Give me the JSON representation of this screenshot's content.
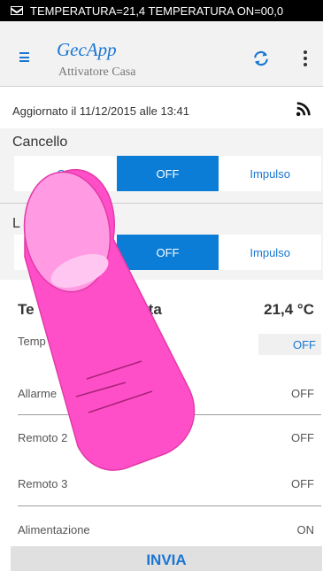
{
  "status_bar": {
    "notification": "TEMPERATURA=21,4 TEMPERATURA ON=00,0"
  },
  "header": {
    "title": "GecApp",
    "subtitle": "Attivatore Casa"
  },
  "updated": "Aggiornato il 11/12/2015 alle 13:41",
  "cancello": {
    "title": "Cancello",
    "options": [
      "ON",
      "OFF",
      "Impulso"
    ],
    "selected": "OFF"
  },
  "luci": {
    "title": "L",
    "options": [
      "OFF",
      "Impulso"
    ],
    "selected": "OFF"
  },
  "temperature": {
    "label_start": "Te",
    "label_end": "evata",
    "value": "21,4 °C"
  },
  "rows": [
    {
      "label": "Temp",
      "label_tail": "ione",
      "value": "OFF"
    },
    {
      "label": "Allarme",
      "value": "OFF"
    },
    {
      "label": "Remoto 2",
      "value": "OFF"
    },
    {
      "label": "Remoto 3",
      "value": "OFF"
    },
    {
      "label": "Alimentazione",
      "value": "ON"
    }
  ],
  "send_button": "INVIA",
  "colors": {
    "accent": "#1976d2",
    "active_segment": "#0b7dd6",
    "finger": "#ff4fc8"
  },
  "icons": [
    "mail-icon",
    "menu-icon",
    "refresh-icon",
    "more-vert-icon",
    "rss-feed-icon"
  ]
}
